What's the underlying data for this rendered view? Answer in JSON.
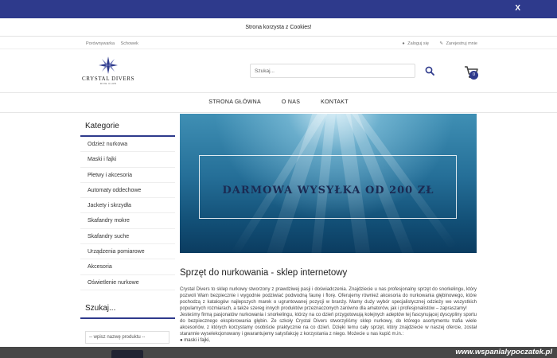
{
  "cookie": {
    "close_label": "X",
    "message": "Strona korzysta z Cookies!"
  },
  "toplinks": {
    "compare": "Porównywarka",
    "cache": "Schowek",
    "login": "Zaloguj się",
    "register": "Zarejestruj mnie"
  },
  "logo": {
    "brand": "CRYSTAL DIVERS",
    "sub": "DIVE CLUB"
  },
  "search": {
    "placeholder": "Szukaj..."
  },
  "cart": {
    "count": "0"
  },
  "nav": {
    "items": [
      "STRONA GŁÓWNA",
      "O NAS",
      "KONTAKT"
    ]
  },
  "sidebar": {
    "title": "Kategorie",
    "categories": [
      "Odzież nurkowa",
      "Maski i fajki",
      "Płetwy i akcesoria",
      "Automaty oddechowe",
      "Jackety i skrzydła",
      "Skafandry mokre",
      "Skafandry suche",
      "Urządzenia pomiarowe",
      "Akcesoria",
      "Oświetlenie nurkowe"
    ],
    "search_title": "Szukaj...",
    "select_value": "-- wpisz nazwę produktu --"
  },
  "banner": {
    "text": "DARMOWA WYSYŁKA OD 200 ZŁ"
  },
  "content": {
    "title": "Sprzęt do nurkowania - sklep internetowy",
    "paragraph1": "Crystal Divers to sklep nurkowy stworzony z prawdziwej pasji i doświadczenia. Znajdziecie u nas profesjonalny sprzęt do snorkelingu, który pozwoli Wam bezpiecznie i wygodnie podziwiać podwodną faunę i florę. Oferujemy również akcesoria do nurkowania głębinowego, które pochodzą z katalogów najlepszych marek o ugruntowanej pozycji w branży. Mamy duży wybór specjalistycznej odzieży we wszystkich popularnych rozmiarach, a także szereg innych produktów przeznaczonych zarówno dla amatorów, jak i profesjonalistów – zapraszamy!",
    "paragraph2": "Jesteśmy firmą pasjonatów nurkowania i snorkelingu, którzy na co dzień przygotowują kolejnych adeptów tej fascynującej dyscypliny sportu do bezpiecznego eksplorowania głębin. Ze szkoły Crystal Divers stworzyliśmy sklep nurkowy, do którego asortymentu trafia wiele akcesoriów, z których korzystamy osobiście praktycznie na co dzień. Dzięki temu cały sprzęt, który znajdziecie w naszej ofercie, został starannie wyselekcjonowany i gwarantujemy satysfakcję z korzystania z niego. Możecie u nas kupić m.in.:",
    "bullet": "● maski i fajki,"
  },
  "watermark": {
    "text": "www.wspanialypoczatek.pl"
  }
}
